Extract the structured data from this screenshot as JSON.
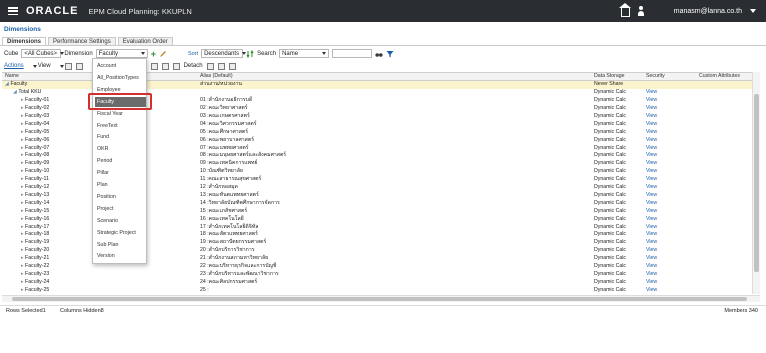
{
  "header": {
    "logo": "ORACLE",
    "app_title": "EPM Cloud Planning: KKUPLN",
    "user": "manasm@lanna.co.th"
  },
  "page": {
    "title": "Dimensions",
    "tabs": [
      "Dimensions",
      "Performance Settings",
      "Evaluation Order"
    ]
  },
  "toolbar": {
    "cube_label": "Cube",
    "cube_value": "<All Cubes>",
    "dimension_label": "Dimension",
    "dimension_value": "Faculty",
    "sort_label": "Sort",
    "sort_value": "Descendants",
    "search_label": "Search",
    "search_value": "Name",
    "actions_label": "Actions",
    "view_label": "View",
    "detach_label": "Detach"
  },
  "grid": {
    "columns": [
      "Name",
      "Alias (Default)",
      "Data Storage",
      "Security",
      "Custom Attributes"
    ],
    "rows": [
      {
        "name": "Faculty",
        "alias": "ส่วนงาน/หน่วยงาน",
        "ds": "Never Share",
        "sec": "",
        "indent": 0
      },
      {
        "name": "Total KKU",
        "alias": "",
        "ds": "Dynamic Calc",
        "sec": "View",
        "indent": 1
      },
      {
        "name": "Faculty-01",
        "alias": "01 :สำนักงานอธิการบดี",
        "ds": "Dynamic Calc",
        "sec": "View",
        "indent": 2
      },
      {
        "name": "Faculty-02",
        "alias": "02 :คณะวิทยาศาสตร์",
        "ds": "Dynamic Calc",
        "sec": "View",
        "indent": 2
      },
      {
        "name": "Faculty-03",
        "alias": "03 :คณะเกษตรศาสตร์",
        "ds": "Dynamic Calc",
        "sec": "View",
        "indent": 2
      },
      {
        "name": "Faculty-04",
        "alias": "04 :คณะวิศวกรรมศาสตร์",
        "ds": "Dynamic Calc",
        "sec": "View",
        "indent": 2
      },
      {
        "name": "Faculty-05",
        "alias": "05 :คณะศึกษาศาสตร์",
        "ds": "Dynamic Calc",
        "sec": "View",
        "indent": 2
      },
      {
        "name": "Faculty-06",
        "alias": "06 :คณะพยาบาลศาสตร์",
        "ds": "Dynamic Calc",
        "sec": "View",
        "indent": 2
      },
      {
        "name": "Faculty-07",
        "alias": "07 :คณะแพทยศาสตร์",
        "ds": "Dynamic Calc",
        "sec": "View",
        "indent": 2
      },
      {
        "name": "Faculty-08",
        "alias": "08 :คณะมนุษยศาสตร์และสังคมศาสตร์",
        "ds": "Dynamic Calc",
        "sec": "View",
        "indent": 2
      },
      {
        "name": "Faculty-09",
        "alias": "09 :คณะเทคนิคการแพทย์",
        "ds": "Dynamic Calc",
        "sec": "View",
        "indent": 2
      },
      {
        "name": "Faculty-10",
        "alias": "10 :บัณฑิตวิทยาลัย",
        "ds": "Dynamic Calc",
        "sec": "View",
        "indent": 2
      },
      {
        "name": "Faculty-11",
        "alias": "11 :คณะสาธารณสุขศาสตร์",
        "ds": "Dynamic Calc",
        "sec": "View",
        "indent": 2
      },
      {
        "name": "Faculty-12",
        "alias": "12 :สำนักหอสมุด",
        "ds": "Dynamic Calc",
        "sec": "View",
        "indent": 2
      },
      {
        "name": "Faculty-13",
        "alias": "13 :คณะทันตแพทยศาสตร์",
        "ds": "Dynamic Calc",
        "sec": "View",
        "indent": 2
      },
      {
        "name": "Faculty-14",
        "alias": "14 :วิทยาลัยบัณฑิตศึกษาการจัดการ",
        "ds": "Dynamic Calc",
        "sec": "View",
        "indent": 2
      },
      {
        "name": "Faculty-15",
        "alias": "15 :คณะเภสัชศาสตร์",
        "ds": "Dynamic Calc",
        "sec": "View",
        "indent": 2
      },
      {
        "name": "Faculty-16",
        "alias": "16 :คณะเทคโนโลยี",
        "ds": "Dynamic Calc",
        "sec": "View",
        "indent": 2
      },
      {
        "name": "Faculty-17",
        "alias": "17 :สำนักเทคโนโลยีดิจิทัล",
        "ds": "Dynamic Calc",
        "sec": "View",
        "indent": 2
      },
      {
        "name": "Faculty-18",
        "alias": "18 :คณะสัตวแพทยศาสตร์",
        "ds": "Dynamic Calc",
        "sec": "View",
        "indent": 2
      },
      {
        "name": "Faculty-19",
        "alias": "19 :คณะสถาปัตยกรรมศาสตร์",
        "ds": "Dynamic Calc",
        "sec": "View",
        "indent": 2
      },
      {
        "name": "Faculty-20",
        "alias": "20 :สำนักบริการวิชาการ",
        "ds": "Dynamic Calc",
        "sec": "View",
        "indent": 2
      },
      {
        "name": "Faculty-21",
        "alias": "21 :สำนักงานสภามหาวิทยาลัย",
        "ds": "Dynamic Calc",
        "sec": "View",
        "indent": 2
      },
      {
        "name": "Faculty-22",
        "alias": "22 :คณะบริหารธุรกิจและการบัญชี",
        "ds": "Dynamic Calc",
        "sec": "View",
        "indent": 2
      },
      {
        "name": "Faculty-23",
        "alias": "23 :สำนักบริหารและพัฒนาวิชาการ",
        "ds": "Dynamic Calc",
        "sec": "View",
        "indent": 2
      },
      {
        "name": "Faculty-24",
        "alias": "24 :คณะศิลปกรรมศาสตร์",
        "ds": "Dynamic Calc",
        "sec": "View",
        "indent": 2
      },
      {
        "name": "Faculty-25",
        "alias": "25 :",
        "ds": "Dynamic Calc",
        "sec": "View",
        "indent": 2
      }
    ]
  },
  "dropdown": {
    "items": [
      "Account",
      "All_PositionTypes",
      "Employee",
      "Faculty",
      "Fiscal Year",
      "FreeText",
      "Fund",
      "OKR",
      "Period",
      "Pillar",
      "Plan",
      "Position",
      "Project",
      "Scenario",
      "Strategic Project",
      "Sub Plan",
      "Version"
    ],
    "selected_index": 3
  },
  "status": {
    "rows_selected": "Rows Selected1",
    "columns_hidden": "Columns Hidden8",
    "members": "Members 340"
  }
}
